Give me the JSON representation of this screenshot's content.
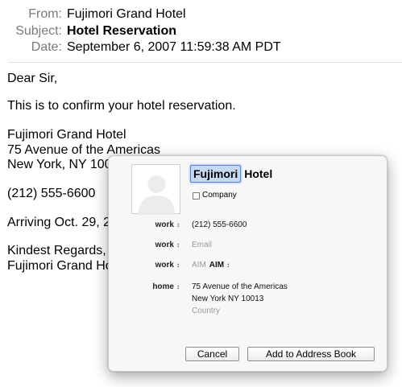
{
  "header": {
    "from_label": "From:",
    "from_value": "Fujimori Grand Hotel",
    "subject_label": "Subject:",
    "subject_value": "Hotel Reservation",
    "date_label": "Date:",
    "date_value": "September 6, 2007 11:59:38 AM PDT"
  },
  "body_lines": [
    "Dear Sir,",
    "This is to confirm your hotel reservation.",
    "Fujimori Grand Hotel",
    "75 Avenue of the Americas",
    "New York, NY 100",
    "(212) 555-6600",
    "Arriving Oct. 29, 2",
    "Kindest Regards,",
    "Fujimori Grand Ho"
  ],
  "card": {
    "first_name": "Fujimori",
    "last_name": "Hotel",
    "company_label": "Company",
    "company_checked": false,
    "fields": {
      "phone_label": "work",
      "phone_value": "(212) 555-6600",
      "email_label": "work",
      "email_placeholder": "Email",
      "aim_label": "work",
      "aim_placeholder": "AIM",
      "aim_type": "AIM",
      "address_label": "home",
      "address_line1": "75 Avenue of the Americas",
      "address_line2": "New York  NY  10013",
      "address_country": "Country"
    },
    "updown_glyph": "↕",
    "cancel_label": "Cancel",
    "add_label": "Add to Address Book"
  },
  "icons": {
    "photo": "person-silhouette-icon",
    "updown": "updown-arrows-icon"
  },
  "colors": {
    "header_label": "#7a7a7a",
    "selection_fill": "#c6d9f2",
    "selection_border": "#5d86c4",
    "placeholder": "#9a9a9a"
  }
}
